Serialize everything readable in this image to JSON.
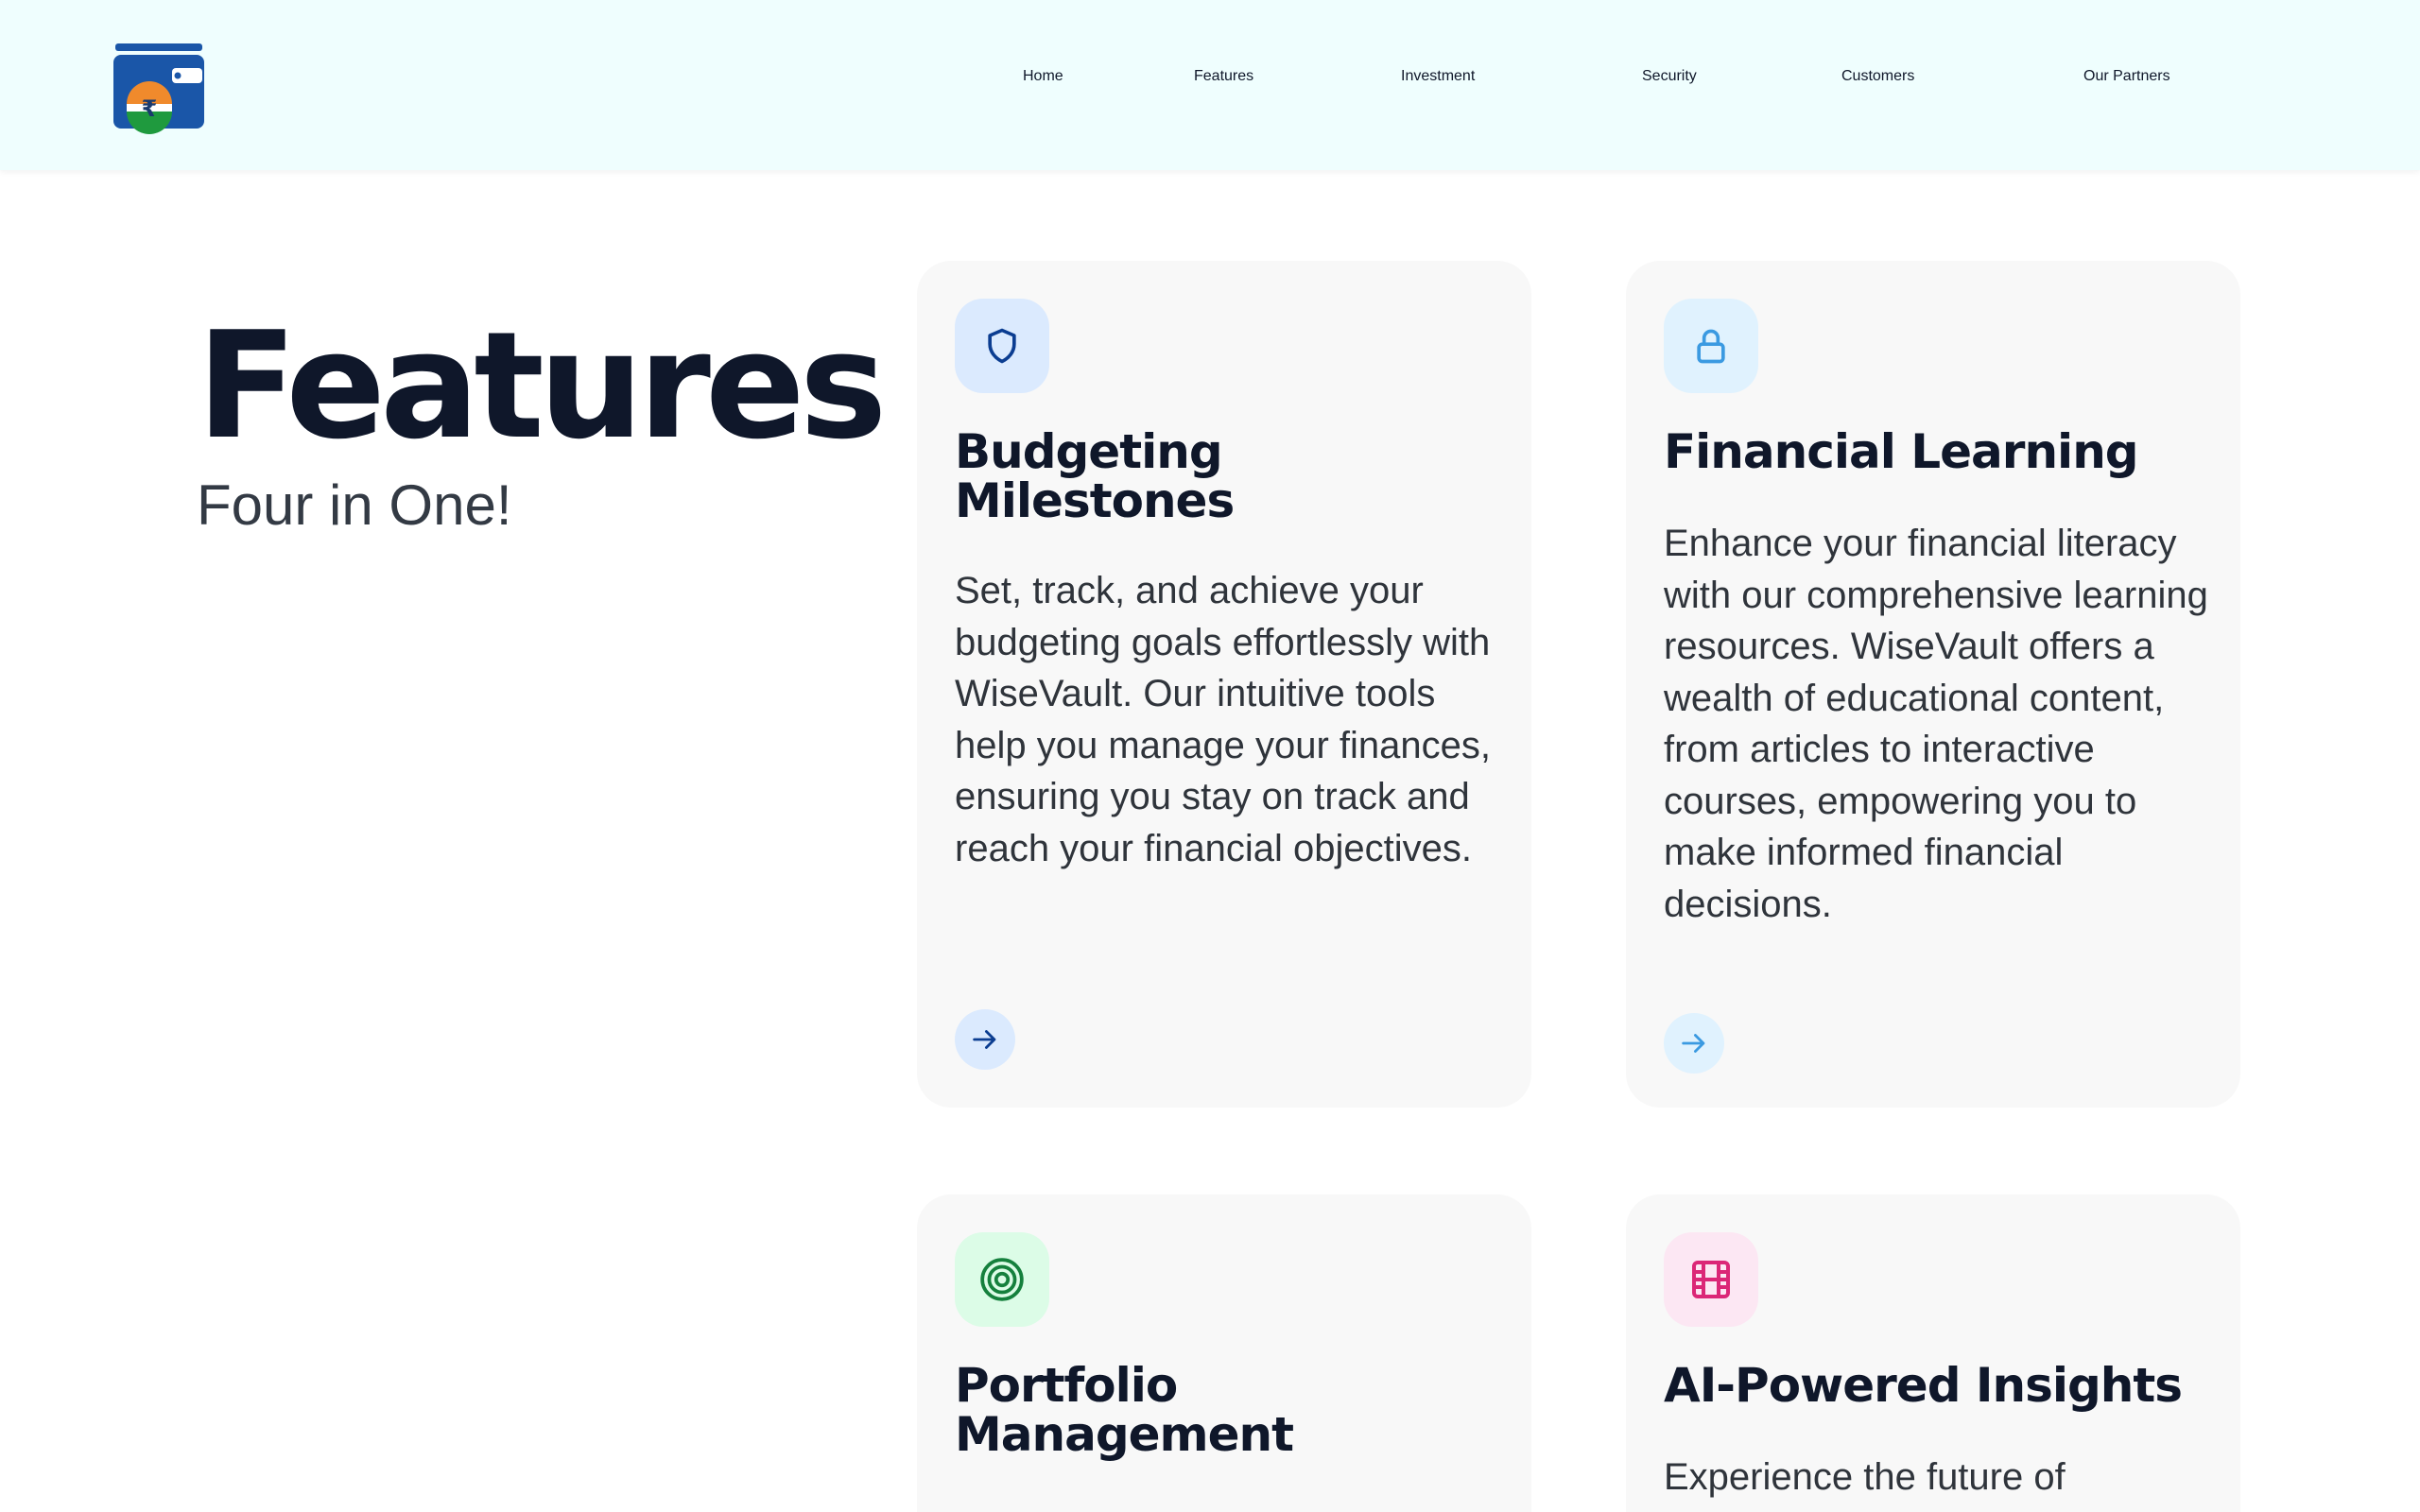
{
  "nav": {
    "items": [
      {
        "label": "Home"
      },
      {
        "label": "Features"
      },
      {
        "label": "Investment"
      },
      {
        "label": "Security"
      },
      {
        "label": "Customers"
      },
      {
        "label": "Our Partners"
      }
    ]
  },
  "hero": {
    "title": "Features",
    "subtitle": "Four in One!"
  },
  "cards": [
    {
      "icon": "shield-icon",
      "accent": "#0b3d91",
      "icon_bg": "#dbeafe",
      "title": "Budgeting Milestones",
      "text": "Set, track, and achieve your budgeting goals effortlessly with WiseVault. Our intuitive tools help you manage your finances, ensuring you stay on track and reach your financial objectives."
    },
    {
      "icon": "lock-icon",
      "accent": "#3b9ae1",
      "icon_bg": "#e0f2fe",
      "title": "Financial Learning",
      "text": "Enhance your financial literacy with our comprehensive learning resources. WiseVault offers a wealth of educational content, from articles to interactive courses, empowering you to make informed financial decisions."
    },
    {
      "icon": "target-icon",
      "accent": "#15803d",
      "icon_bg": "#dcfce7",
      "title": "Portfolio Management",
      "text": ""
    },
    {
      "icon": "film-icon",
      "accent": "#db2777",
      "icon_bg": "#fce7f3",
      "title": "AI-Powered Insights",
      "text": "Experience the future of"
    }
  ]
}
